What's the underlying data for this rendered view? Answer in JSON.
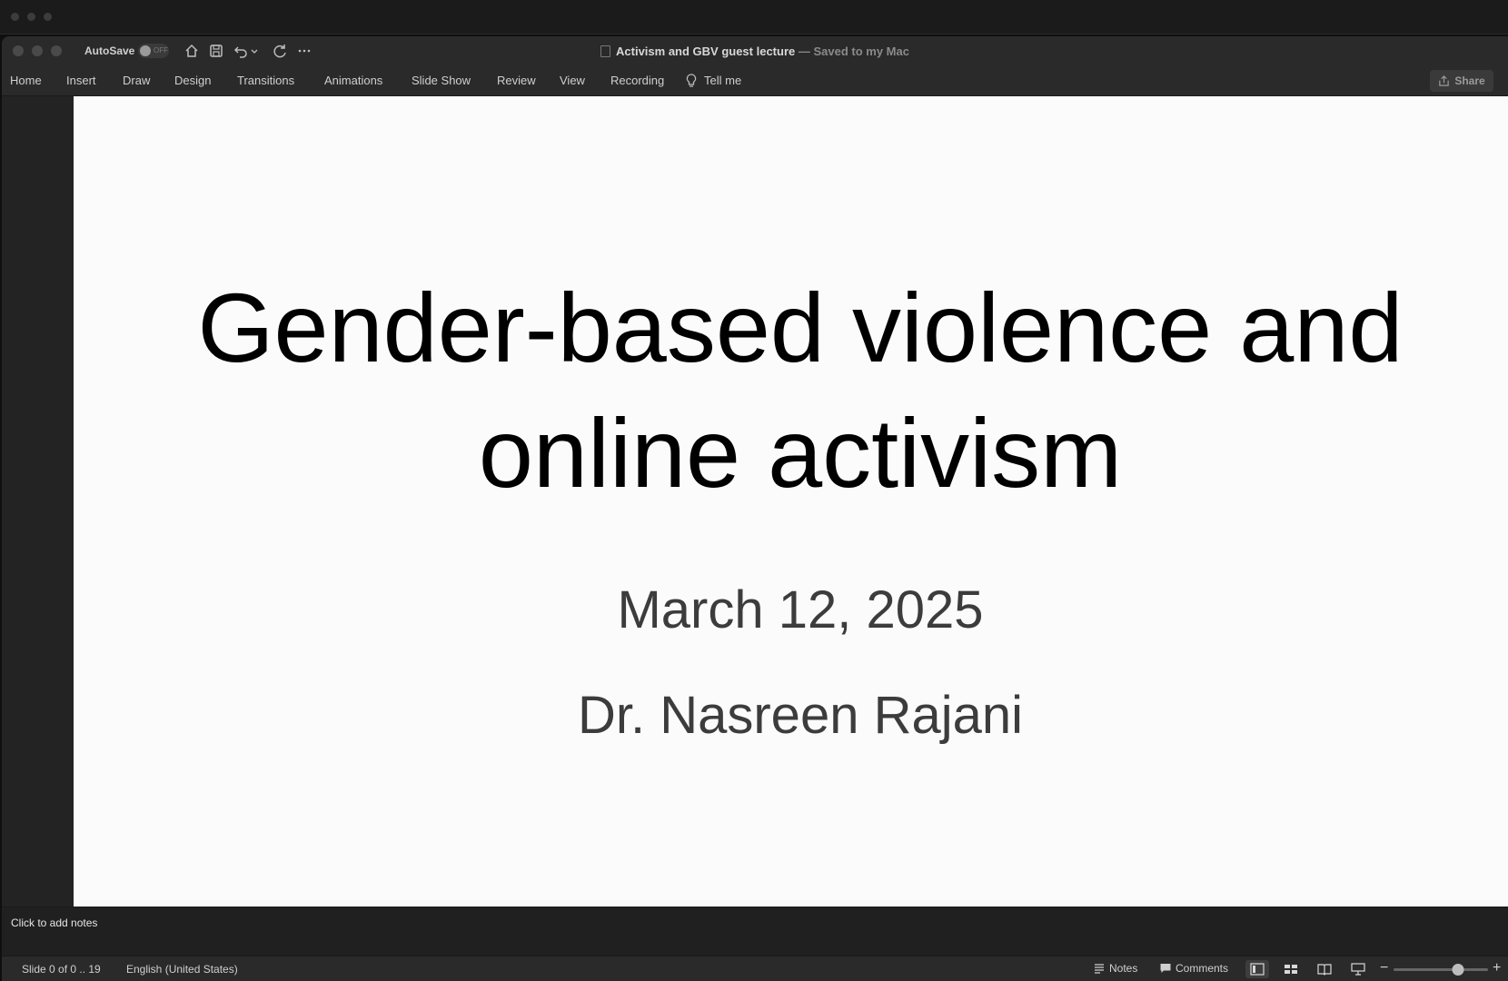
{
  "window": {
    "autosave_label": "AutoSave",
    "autosave_state": "OFF",
    "doc_name": "Activism and GBV guest lecture",
    "doc_status": " — Saved to my Mac"
  },
  "ribbon": {
    "tabs": [
      "Home",
      "Insert",
      "Draw",
      "Design",
      "Transitions",
      "Animations",
      "Slide Show",
      "Review",
      "View",
      "Recording"
    ],
    "tell_me": "Tell me",
    "share": "Share"
  },
  "slide": {
    "title_line1": "Gender-based violence and",
    "title_line2": "online activism",
    "date": "March 12, 2025",
    "author": "Dr. Nasreen Rajani"
  },
  "notes": {
    "placeholder": "Click to add notes"
  },
  "status": {
    "slide_counter": "Slide 0 of 0 .. 19",
    "language": "English (United States)",
    "notes": "Notes",
    "comments": "Comments",
    "zoom_level": 0.68
  },
  "icons": {
    "home": "home-icon",
    "save": "save-icon",
    "undo": "undo-icon",
    "redo": "redo-icon",
    "more": "more-icon",
    "tell_me": "lightbulb-icon",
    "share": "share-icon"
  }
}
